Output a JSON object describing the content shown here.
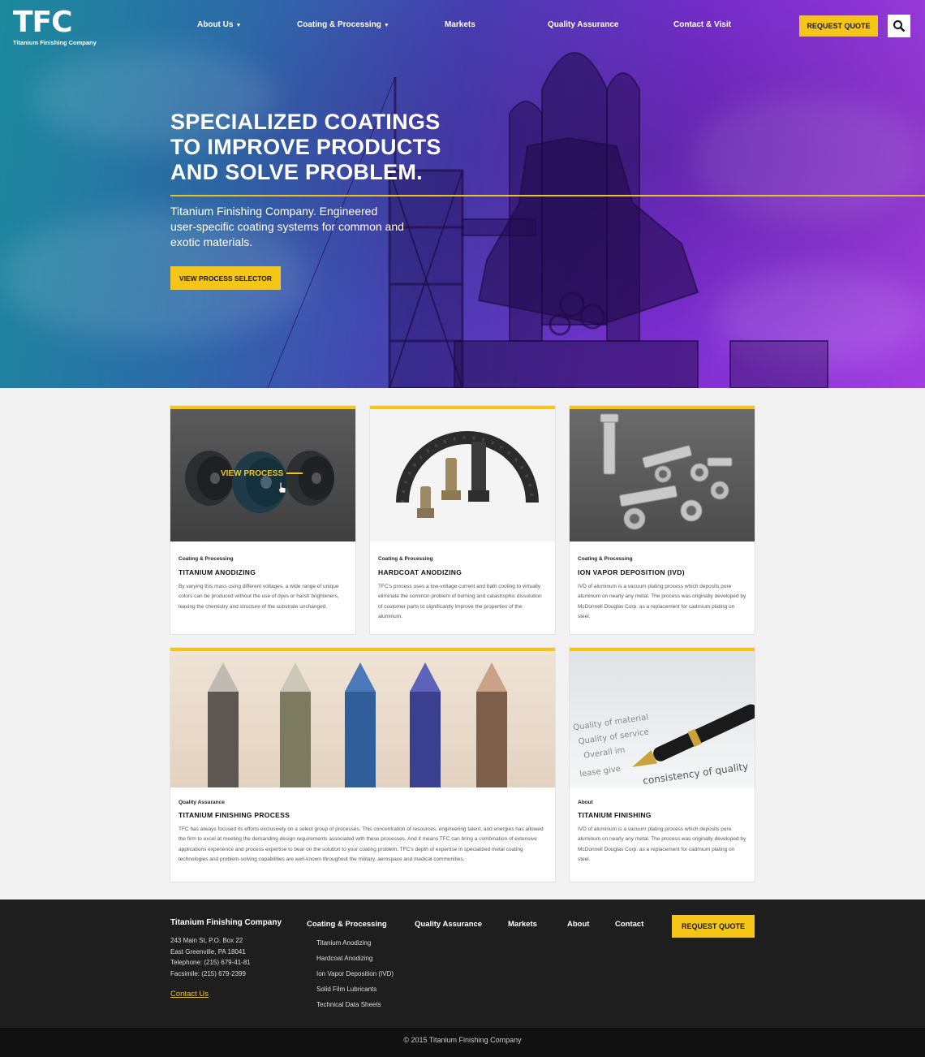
{
  "brand": {
    "logo_mark": "TFC",
    "logo_subtitle": "Titanium Finishing Company",
    "accent_color": "#f5c518",
    "footer_color": "#1e1e1e"
  },
  "nav": {
    "about": "About Us",
    "coating": "Coating & Processing",
    "markets": "Markets",
    "quality": "Quality Assurance",
    "contact": "Contact & Visit",
    "request_quote": "REQUEST QUOTE",
    "search_icon": "search-icon"
  },
  "hero": {
    "title_line1": "SPECIALIZED COATINGS",
    "title_line2": "TO IMPROVE PRODUCTS",
    "title_line3": "AND SOLVE PROBLEM.",
    "subtitle": "Titanium Finishing Company. Engineered user-specific coating systems for common and exotic materials.",
    "button": "VIEW PROCESS SELECTOR"
  },
  "cards": [
    {
      "category": "Coating & Processing",
      "title": "TITANIUM ANODIZING",
      "description": "By varying this mass using different voltages, a wide range of unique colors can be produced without the use of dyes or harsh brighteners, leaving the chemistry and structure of the substrate unchanged.",
      "overlay": "VIEW PROCESS"
    },
    {
      "category": "Coating & Processing",
      "title": "HARDCOAT ANODIZING",
      "description": "TFC's process uses a low-voltage current and bath cooling to virtually eliminate the common problem of burning and catastrophic dissolution of customer parts to significantly improve the properties of the aluminum."
    },
    {
      "category": "Coating & Processing",
      "title": "ION VAPOR DEPOSITION (IVD)",
      "description": "IVD of aluminum is a vacuum plating process which deposits pure aluminum on nearly any metal. The process was originally developed by McDonnell Douglas Corp. as a replacement for cadmium plating on steel."
    },
    {
      "category": "Quality Assurance",
      "title": "TITANIUM FINISHING PROCESS",
      "description": "TFC has always focused its efforts exclusively on a select group of processes. This concentration of resources, engineering talent, and energies has allowed the firm to excel at meeting the demanding design requirements associated with these processes. And it means TFC can bring a combination of extensive applications experience and process expertise to bear on the solution to your coating problem. TFC's depth of expertise in specialized metal coating technologies and problem-solving capabilities are well-known throughout the military, aerospace and medical communities."
    },
    {
      "category": "About",
      "title": "TITANIUM FINISHING",
      "description": "IVD of aluminum is a vacuum plating process which deposits pure aluminum on nearly any metal. The process was originally developed by McDonnell Douglas Corp. as a replacement for cadmium plating on steel.",
      "doc_text_1": "Quality of material",
      "doc_text_2": "Quality of service",
      "doc_text_3": "Overall im",
      "doc_text_4": "lease give",
      "doc_text_5": "consistency of quality"
    }
  ],
  "footer": {
    "company": "Titanium Finishing Company",
    "address_1": "243 Main St, P.O. Box 22",
    "address_2": "East Greenville, PA 18041",
    "telephone": "Telephone: (215) 679-41-81",
    "facsimile": "Facsimile: (215) 679-2399",
    "contact_link": "Contact Us",
    "nav_coating": "Coating & Processing",
    "nav_quality": "Quality Assurance",
    "nav_markets": "Markets",
    "nav_about": "About",
    "nav_contact": "Contact",
    "request_quote": "REQUEST QUOTE",
    "sub_items": [
      "Titanium Anodizing",
      "Hardcoat Anodizing",
      "Ion Vapor Deposition (IVD)",
      "Solid Film Lubricants",
      "Technical Data Sheets"
    ],
    "copyright": "© 2015 Titanium Finishing Company"
  }
}
